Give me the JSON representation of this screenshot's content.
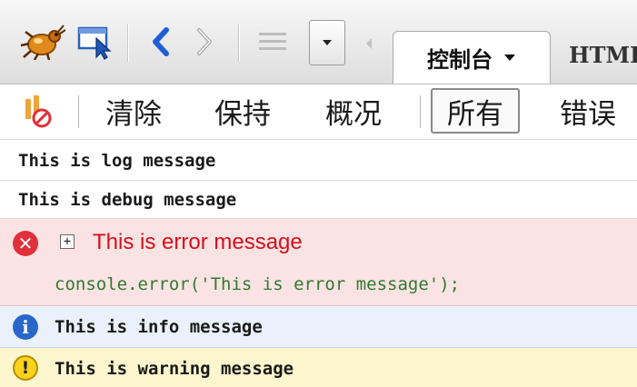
{
  "toolbar": {
    "icons": [
      "firebug-bug-icon",
      "inspect-element-icon",
      "back-arrow-icon",
      "forward-arrow-icon",
      "menu-lines-icon",
      "dropdown-arrow-icon",
      "left-scroll-arrow-icon"
    ],
    "tabs": [
      {
        "label": "控制台",
        "active": true,
        "has_dropdown": true
      },
      {
        "label": "HTML",
        "active": false
      }
    ]
  },
  "filter_bar": {
    "clear_label": "清除",
    "persist_label": "保持",
    "profile_label": "概况",
    "all_label": "所有",
    "errors_label": "错误",
    "active_filter": "所有"
  },
  "console": {
    "rows": [
      {
        "type": "log",
        "text": "This is log message"
      },
      {
        "type": "debug",
        "text": "This is debug message"
      },
      {
        "type": "error",
        "text": "This is error message",
        "source": "console.error('This is error message');"
      },
      {
        "type": "info",
        "text": "This is info message"
      },
      {
        "type": "warning",
        "text": "This is warning message"
      }
    ]
  },
  "colors": {
    "error_bg": "#fbe3e4",
    "error_text": "#d4101b",
    "error_code": "#2f7a2f",
    "info_bg": "#eaf1fb",
    "info_icon": "#2867c9",
    "warning_bg": "#fbf6cd",
    "warning_icon": "#ffd21c",
    "nav_blue": "#1f5fd6"
  }
}
